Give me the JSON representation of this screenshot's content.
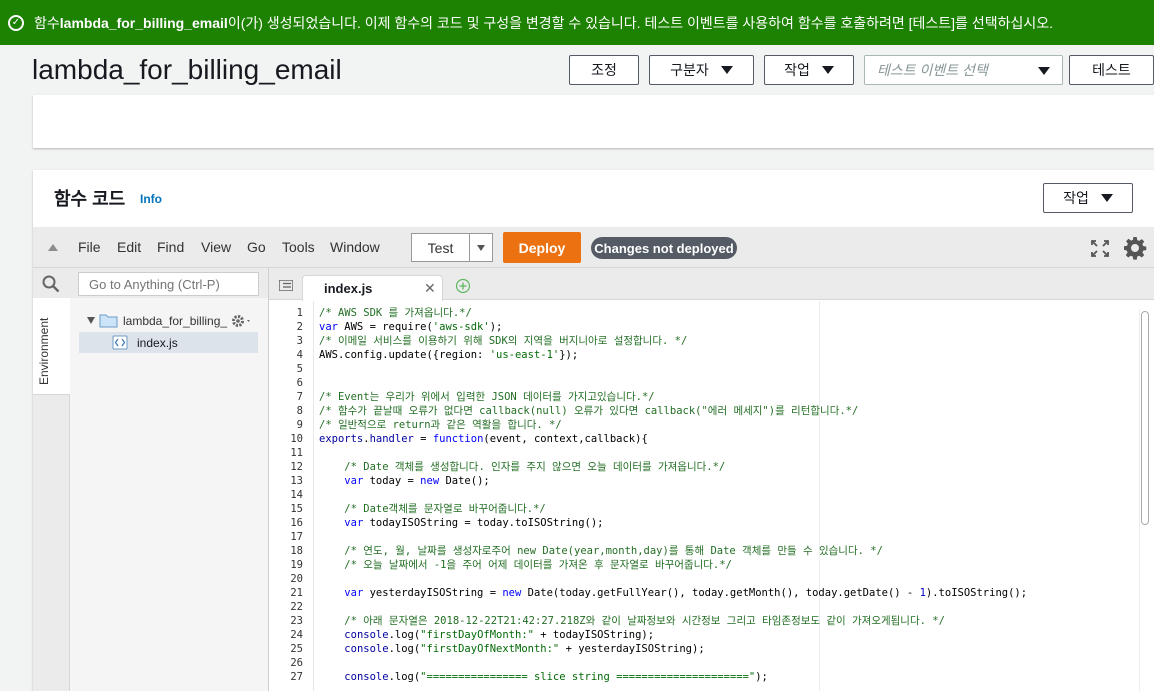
{
  "banner": {
    "prefix": "함수 ",
    "function_name": "lambda_for_billing_email",
    "message": "이(가) 생성되었습니다. 이제 함수의 코드 및 구성을 변경할 수 있습니다. 테스트 이벤트를 사용하여 함수를 호출하려면 [테스트]를 선택하십시오."
  },
  "header": {
    "title": "lambda_for_billing_email",
    "throttle_label": "조정",
    "qualifiers_label": "구분자",
    "actions_label": "작업",
    "test_event_placeholder": "테스트 이벤트 선택",
    "test_label": "테스트"
  },
  "code_panel": {
    "title": "함수 코드",
    "info_label": "Info",
    "actions_label": "작업"
  },
  "ide": {
    "menu": [
      "File",
      "Edit",
      "Find",
      "View",
      "Go",
      "Tools",
      "Window"
    ],
    "test_label": "Test",
    "deploy_label": "Deploy",
    "status_badge": "Changes not deployed",
    "search_placeholder": "Go to Anything (Ctrl-P)",
    "environment_label": "Environment",
    "folder_name": "lambda_for_billing_",
    "file_name": "index.js",
    "tab_name": "index.js"
  },
  "colors": {
    "banner": "#1d8102",
    "deploy": "#ec7211",
    "badge": "#545b64",
    "link": "#0073bb"
  },
  "editor": {
    "line_numbers": [
      "1",
      "2",
      "3",
      "4",
      "5",
      "6",
      "7",
      "8",
      "9",
      "10",
      "11",
      "12",
      "13",
      "14",
      "15",
      "16",
      "17",
      "18",
      "19",
      "20",
      "21",
      "22",
      "23",
      "24",
      "25",
      "26",
      "27"
    ],
    "lines": [
      [
        {
          "t": "c",
          "v": "/* AWS SDK 를 가져옵니다.*/"
        }
      ],
      [
        {
          "t": "k",
          "v": "var"
        },
        {
          "t": "p",
          "v": " AWS = require("
        },
        {
          "t": "s",
          "v": "'aws-sdk'"
        },
        {
          "t": "p",
          "v": ");"
        }
      ],
      [
        {
          "t": "c",
          "v": "/* 이메일 서비스를 이용하기 위해 SDK의 지역을 버지니아로 설정합니다. */"
        }
      ],
      [
        {
          "t": "p",
          "v": "AWS.config.update({region: "
        },
        {
          "t": "s",
          "v": "'us-east-1'"
        },
        {
          "t": "p",
          "v": "});"
        }
      ],
      [],
      [],
      [
        {
          "t": "c",
          "v": "/* Event는 우리가 위에서 입력한 JSON 데이터를 가지고있습니다.*/"
        }
      ],
      [
        {
          "t": "c",
          "v": "/* 함수가 끝날때 오류가 없다면 callback(null) 오류가 있다면 callback(\"에러 메세지\")를 리턴합니다.*/"
        }
      ],
      [
        {
          "t": "c",
          "v": "/* 일반적으로 return과 같은 역활을 합니다. */"
        }
      ],
      [
        {
          "t": "f",
          "v": "exports"
        },
        {
          "t": "p",
          "v": "."
        },
        {
          "t": "f",
          "v": "handler"
        },
        {
          "t": "p",
          "v": " = "
        },
        {
          "t": "k",
          "v": "function"
        },
        {
          "t": "p",
          "v": "(event, context,callback){"
        }
      ],
      [],
      [
        {
          "t": "p",
          "v": "    "
        },
        {
          "t": "c",
          "v": "/* Date 객체를 생성합니다. 인자를 주지 않으면 오늘 데이터를 가져옵니다.*/"
        }
      ],
      [
        {
          "t": "p",
          "v": "    "
        },
        {
          "t": "k",
          "v": "var"
        },
        {
          "t": "p",
          "v": " today = "
        },
        {
          "t": "k",
          "v": "new"
        },
        {
          "t": "p",
          "v": " Date();"
        }
      ],
      [],
      [
        {
          "t": "p",
          "v": "    "
        },
        {
          "t": "c",
          "v": "/* Date객체를 문자열로 바꾸어줍니다.*/"
        }
      ],
      [
        {
          "t": "p",
          "v": "    "
        },
        {
          "t": "k",
          "v": "var"
        },
        {
          "t": "p",
          "v": " todayISOString = today.toISOString();"
        }
      ],
      [],
      [
        {
          "t": "p",
          "v": "    "
        },
        {
          "t": "c",
          "v": "/* 연도, 월, 날짜를 생성자로주어 new Date(year,month,day)를 통해 Date 객체를 만들 수 있습니다. */"
        }
      ],
      [
        {
          "t": "p",
          "v": "    "
        },
        {
          "t": "c",
          "v": "/* 오늘 날짜에서 -1을 주어 어제 데이터를 가져온 후 문자열로 바꾸어줍니다.*/"
        }
      ],
      [],
      [
        {
          "t": "p",
          "v": "    "
        },
        {
          "t": "k",
          "v": "var"
        },
        {
          "t": "p",
          "v": " yesterdayISOString = "
        },
        {
          "t": "k",
          "v": "new"
        },
        {
          "t": "p",
          "v": " Date(today.getFullYear(), today.getMonth(), today.getDate() - "
        },
        {
          "t": "n",
          "v": "1"
        },
        {
          "t": "p",
          "v": ").toISOString();"
        }
      ],
      [],
      [
        {
          "t": "p",
          "v": "    "
        },
        {
          "t": "c",
          "v": "/* 아래 문자열은 2018-12-22T21:42:27.218Z와 같이 날짜정보와 시간정보 그리고 타임존정보도 같이 가져오게됩니다. */"
        }
      ],
      [
        {
          "t": "p",
          "v": "    "
        },
        {
          "t": "f",
          "v": "console"
        },
        {
          "t": "p",
          "v": ".log("
        },
        {
          "t": "s",
          "v": "\"firstDayOfMonth:\""
        },
        {
          "t": "p",
          "v": " + todayISOString);"
        }
      ],
      [
        {
          "t": "p",
          "v": "    "
        },
        {
          "t": "f",
          "v": "console"
        },
        {
          "t": "p",
          "v": ".log("
        },
        {
          "t": "s",
          "v": "\"firstDayOfNextMonth:\""
        },
        {
          "t": "p",
          "v": " + yesterdayISOString);"
        }
      ],
      [],
      [
        {
          "t": "p",
          "v": "    "
        },
        {
          "t": "f",
          "v": "console"
        },
        {
          "t": "p",
          "v": ".log("
        },
        {
          "t": "s",
          "v": "\"================ slice string =====================\""
        },
        {
          "t": "p",
          "v": ");"
        }
      ]
    ]
  }
}
